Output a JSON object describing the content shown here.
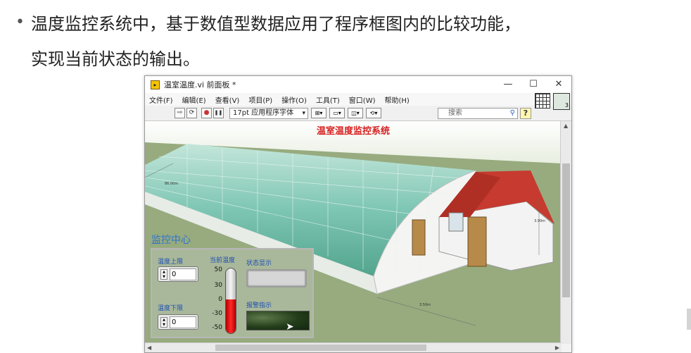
{
  "slide": {
    "bullet": "•",
    "line1": "温度监控系统中，基于数值型数据应用了程序框图内的比较功能，",
    "line2": "实现当前状态的输出。"
  },
  "window": {
    "title": "温室温度.vi 前面板 *",
    "controls": {
      "minimize": "—",
      "maximize": "☐",
      "close": "✕"
    }
  },
  "menu": [
    "文件(F)",
    "编辑(E)",
    "查看(V)",
    "项目(P)",
    "操作(O)",
    "工具(T)",
    "窗口(W)",
    "帮助(H)"
  ],
  "toolbar": {
    "run_icon": "⇨",
    "run_continuous_icon": "⟳",
    "abort_icon": "●",
    "pause_icon": "❚❚",
    "font_select": "17pt 应用程序字体",
    "align_icon": "⊞▾",
    "distribute_icon": "▭▾",
    "resize_icon": "◫▾",
    "reorder_icon": "⟲▾",
    "search_placeholder": "搜索",
    "help_label": "?",
    "vi_icon_number": "3"
  },
  "panel": {
    "title": "温室温度监控系统",
    "greenhouse_dims": {
      "length": "86.00m",
      "width": "3.50m",
      "height": "3.90m"
    },
    "monitor_center": "监控中心",
    "upper_limit_label": "温度上限",
    "upper_limit_value": "0",
    "lower_limit_label": "温度下限",
    "lower_limit_value": "0",
    "current_temp_label": "当前温度",
    "thermo_ticks": [
      "50",
      "30",
      "0",
      "-30",
      "-50"
    ],
    "thermo_level_percent": 52,
    "status_label": "状态显示",
    "status_value": "",
    "alarm_label": "报警指示"
  },
  "colors": {
    "panel_title": "#d61f1f",
    "labels": "#1d4fb3",
    "roof": "#c63a2f",
    "greenhouse_glass": "#79c4b4",
    "ground": "#8fa576"
  }
}
